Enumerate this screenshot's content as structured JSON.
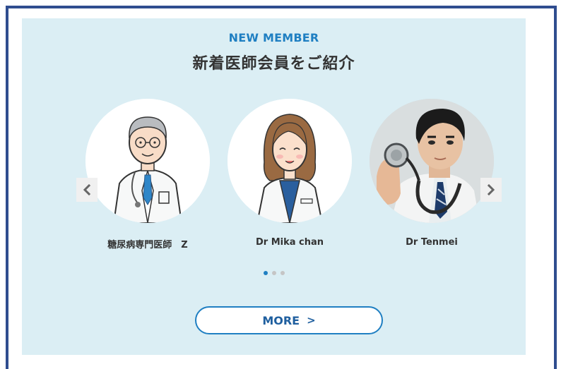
{
  "section": {
    "eyebrow": "NEW MEMBER",
    "title": "新着医師会員をご紹介"
  },
  "members": [
    {
      "name": "糖尿病専門医師　Z",
      "avatar": "elderly-doctor-illustration"
    },
    {
      "name": "Dr Mika chan",
      "avatar": "female-doctor-illustration"
    },
    {
      "name": "Dr Tenmei",
      "avatar": "doctor-with-stethoscope-photo"
    }
  ],
  "carousel": {
    "prev_icon": "chevron-left-icon",
    "next_icon": "chevron-right-icon",
    "page_count": 3,
    "active_page": 1
  },
  "more_button": {
    "label": "MORE",
    "icon": "chevron-right-icon"
  },
  "colors": {
    "accent": "#1f7fc2",
    "panel_bg": "#dbeef4",
    "frame_border": "#2f4d8f"
  }
}
